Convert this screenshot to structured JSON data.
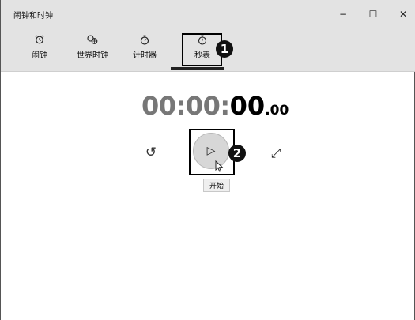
{
  "window": {
    "title": "闹钟和时钟",
    "minimize": "−",
    "maximize": "☐",
    "close": "✕"
  },
  "tabs": [
    {
      "label": "闹钟",
      "icon": "alarm-clock-icon",
      "glyph": "⏰"
    },
    {
      "label": "世界时钟",
      "icon": "world-clock-icon",
      "glyph": "🌐"
    },
    {
      "label": "计时器",
      "icon": "timer-icon",
      "glyph": "⏱"
    },
    {
      "label": "秒表",
      "icon": "stopwatch-icon",
      "glyph": "⏱"
    }
  ],
  "selected_tab": "秒表",
  "stopwatch": {
    "hours": "00",
    "sep1": ":",
    "minutes": "00",
    "sep2": ":",
    "seconds": "00",
    "hundredths": ".00"
  },
  "controls": {
    "reset_glyph": "↺",
    "start_glyph": "▷",
    "expand_glyph": "⤢",
    "start_tooltip": "开始"
  },
  "markers": {
    "one": "1",
    "two": "2"
  },
  "colors": {
    "titlebar_bg": "#e3e3e3",
    "start_button_bg": "#d7d7d7",
    "time_grey": "#777777"
  }
}
